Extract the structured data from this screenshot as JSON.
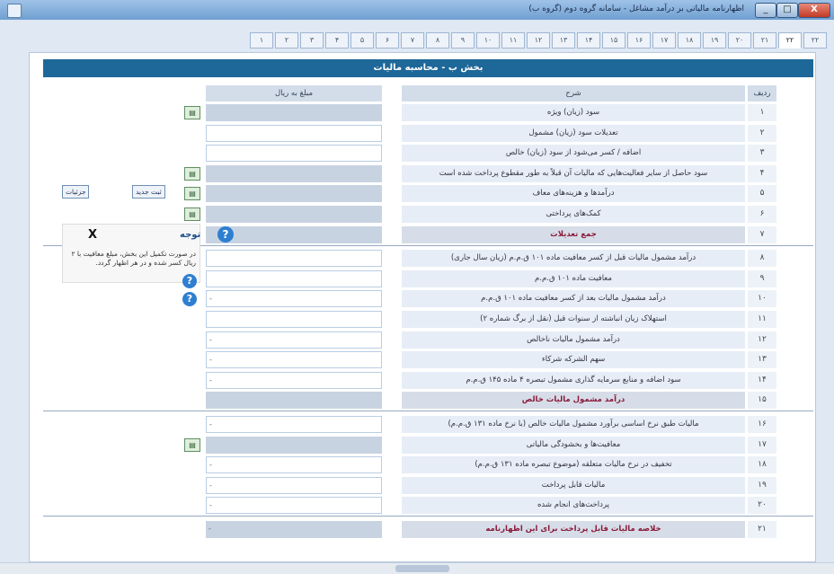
{
  "window": {
    "title": "اظهارنامه مالیاتی بر درآمد مشاغل - سامانه گروه دوم (گروه ب)",
    "minimize": "_",
    "maximize": "□",
    "close": "X"
  },
  "tabs": [
    "۲۲",
    "۲۲",
    "۲۱",
    "۲۰",
    "۱۹",
    "۱۸",
    "۱۷",
    "۱۶",
    "۱۵",
    "۱۴",
    "۱۳",
    "۱۲",
    "۱۱",
    "۱۰",
    "۹",
    "۸",
    "۷",
    "۶",
    "۵",
    "۴",
    "۳",
    "۲",
    "۱"
  ],
  "active_tab_index": 1,
  "section": {
    "title": "بخش ب - محاسبه مالیات"
  },
  "columns": {
    "row": "ردیف",
    "description": "شرح",
    "amount": "مبلغ به ریال"
  },
  "rows": [
    {
      "num": "۱",
      "desc": "سود (زیان) ویژه",
      "field": "ro",
      "calc": true
    },
    {
      "num": "۲",
      "desc": "تعدیلات سود (زیان) مشمول",
      "field": "edit"
    },
    {
      "num": "۳",
      "desc": "اضافه / کسر می‌شود از سود (زیان) خالص",
      "field": "edit"
    },
    {
      "num": "۴",
      "desc": "سود حاصل از سایر فعالیت‌هایی که مالیات آن قبلاً به طور مقطوع پرداخت شده است",
      "field": "ro",
      "calc": true
    },
    {
      "num": "۵",
      "desc": "درآمدها و هزینه‌های معاف",
      "field": "ro",
      "calc": true
    },
    {
      "num": "۶",
      "desc": "کمک‌های پرداختی",
      "field": "ro",
      "calc": true
    },
    {
      "num": "۷",
      "desc": "جمع تعدیلات",
      "field": "ro",
      "highlight": true
    },
    {
      "num": "۸",
      "desc": "درآمد مشمول مالیات قبل از کسر معافیت ماده ۱۰۱ ق.م.م (زیان سال جاری)",
      "field": "edit"
    },
    {
      "num": "۹",
      "desc": "معافیت ماده ۱۰۱ ق.م.م",
      "field": "edit"
    },
    {
      "num": "۱۰",
      "desc": "درآمد مشمول مالیات بعد از کسر معافیت ماده ۱۰۱ ق.م.م",
      "field": "edit",
      "mark": "-"
    },
    {
      "num": "۱۱",
      "desc": "استهلاک زیان انباشته از سنوات قبل (نقل از برگ شماره ۲)",
      "field": "edit"
    },
    {
      "num": "۱۲",
      "desc": "درآمد مشمول مالیات ناخالص",
      "field": "edit",
      "mark": "-"
    },
    {
      "num": "۱۳",
      "desc": "سهم الشرکه شرکاء",
      "field": "edit",
      "mark": "-"
    },
    {
      "num": "۱۴",
      "desc": "سود اضافه و منابع سرمایه گذاری مشمول تبصره ۴ ماده ۱۴۵ ق.م.م",
      "field": "edit",
      "mark": "-"
    },
    {
      "num": "۱۵",
      "desc": "درآمد مشمول مالیات خالص",
      "field": "ro",
      "highlight": true
    },
    {
      "num": "۱۶",
      "desc": "مالیات طبق نرخ اساسی برآورد مشمول مالیات خالص (با نرخ ماده ۱۳۱ ق.م.م)",
      "field": "edit",
      "mark": "-"
    },
    {
      "num": "۱۷",
      "desc": "معافیت‌ها و بخشودگی مالیاتی",
      "field": "ro",
      "calc": true
    },
    {
      "num": "۱۸",
      "desc": "تخفیف در نرخ مالیات متعلقه (موضوع تبصره ماده ۱۳۱ ق.م.م)",
      "field": "edit",
      "mark": "-"
    },
    {
      "num": "۱۹",
      "desc": "مالیات قابل پرداخت",
      "field": "edit",
      "mark": "-"
    },
    {
      "num": "۲۰",
      "desc": "پرداخت‌های انجام شده",
      "field": "edit",
      "mark": "-"
    },
    {
      "num": "۲۱",
      "desc": "خلاصه مالیات قابل پرداخت برای این اظهارنامه",
      "field": "ro",
      "highlight": true,
      "mark": "-"
    }
  ],
  "side_buttons": {
    "add": "ثبت جدید",
    "detail": "جزئیات"
  },
  "note": {
    "close": "X",
    "title": "توجه",
    "text": "در صورت تکمیل این بخش، مبلغ معافیت با ۲ ریال کسر شده و در هر اظهار گردد."
  },
  "help_icon": "?"
}
